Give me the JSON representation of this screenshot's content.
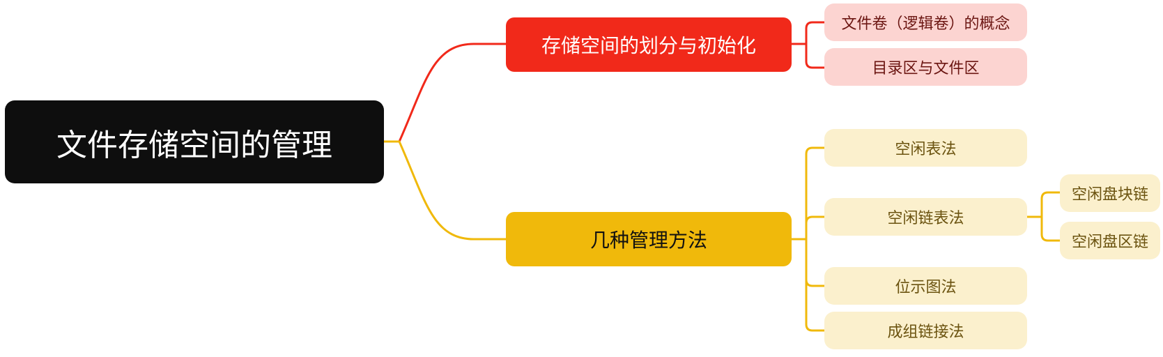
{
  "root": {
    "label": "文件存储空间的管理"
  },
  "branches": [
    {
      "label": "存储空间的划分与初始化",
      "color": "#f1291a",
      "children": [
        {
          "label": "文件卷（逻辑卷）的概念"
        },
        {
          "label": "目录区与文件区"
        }
      ]
    },
    {
      "label": "几种管理方法",
      "color": "#f0b90b",
      "children": [
        {
          "label": "空闲表法"
        },
        {
          "label": "空闲链表法",
          "children": [
            {
              "label": "空闲盘块链"
            },
            {
              "label": "空闲盘区链"
            }
          ]
        },
        {
          "label": "位示图法"
        },
        {
          "label": "成组链接法"
        }
      ]
    }
  ]
}
